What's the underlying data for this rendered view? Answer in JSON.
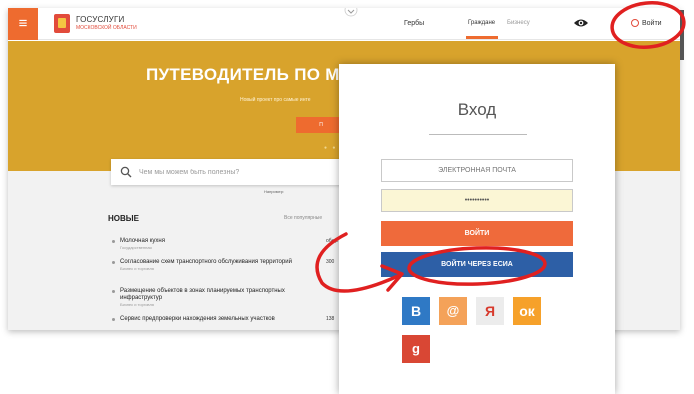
{
  "header": {
    "menu_icon": "hamburger-icon",
    "logo_main": "ГОСУСЛУГИ",
    "logo_sub": "МОСКОВСКОЙ ОБЛАСТИ",
    "nav_gerby": "Гербы",
    "nav_primary": "Граждане",
    "nav_secondary": "Бизнесу",
    "accessibility_icon": "eye-icon",
    "login_label": "Войти"
  },
  "hero": {
    "title": "ПУТЕВОДИТЕЛЬ ПО МО",
    "subtitle": "Новый проект про самые инте",
    "button_label": "П",
    "dots": "● ● ● ●"
  },
  "search": {
    "placeholder": "Чем мы можем быть полезны?",
    "hint": "Например:"
  },
  "news": {
    "title": "НОВЫЕ",
    "more": "Все популярные",
    "items": [
      {
        "title": "Молочная кухня",
        "sub": "Государственная",
        "count": "обще"
      },
      {
        "title": "Согласование схем транспортного обслуживания территорий",
        "sub": "Бизнес и торговля",
        "count": "300"
      },
      {
        "title": "Размещение объектов в зонах планируемых транспортных инфраструктур",
        "sub": "Бизнес и торговля",
        "count": ""
      },
      {
        "title": "Сервис предпроверки нахождения земельных участков",
        "sub": "",
        "count": "138"
      }
    ]
  },
  "login_modal": {
    "title": "Вход",
    "email_placeholder": "ЭЛЕКТРОННАЯ ПОЧТА",
    "password_value": "••••••••••",
    "login_button": "ВОЙТИ",
    "esia_button": "ВОЙТИ ЧЕРЕЗ ЕСИА",
    "social": [
      {
        "name": "vk",
        "glyph": "В"
      },
      {
        "name": "mail",
        "glyph": "@"
      },
      {
        "name": "yandex",
        "glyph": "Я"
      },
      {
        "name": "odnoklassniki",
        "glyph": "ок"
      },
      {
        "name": "google",
        "glyph": "g"
      }
    ]
  },
  "colors": {
    "accent": "#ee6b2f",
    "hero": "#d8a32c",
    "esia": "#2d5fa6",
    "annotation": "#e02020"
  }
}
